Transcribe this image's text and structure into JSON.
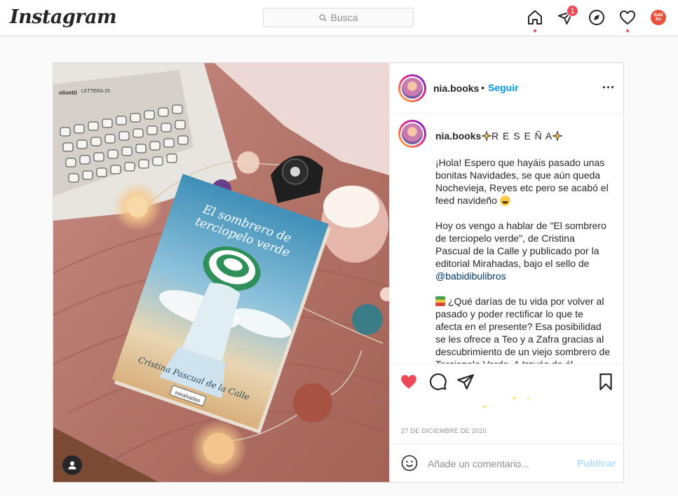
{
  "nav": {
    "logo": "Instagram",
    "search_placeholder": "Busca",
    "notifications_count": "1",
    "avatar_text": "Babi Bu"
  },
  "post": {
    "username": "nia.books",
    "separator": "•",
    "follow_label": "Seguir",
    "caption_title": "R E S E Ñ A",
    "caption_p1": "¡Hola! Espero que hayáis pasado unas bonitas Navidades, se que aún queda Nochevieja, Reyes etc pero se acabó el feed navideño",
    "caption_p2_a": "Hoy os vengo a hablar de \"El sombrero de terciopelo verde\", de Cristina Pascual de la Calle y publicado por la editorial Mirahadas, bajo el sello de",
    "caption_p2_mention": "@babidibulibros",
    "caption_p3": "¿Qué darías de tu vida por volver al pasado y poder rectificar lo que te afecta en el presente? Esa posibilidad se les ofrece a Teo y a Zafra gracias al descubrimiento de un viejo sombrero de Terciopelo Verde. A través de él",
    "date": "27 DE DICIEMBRE DE 2020",
    "comment_placeholder": "Añade un comentario...",
    "publish_label": "Publicar"
  },
  "photo": {
    "book_title_line1": "El sombrero de",
    "book_title_line2": "terciopelo verde",
    "book_author": "Cristina Pascual de la Calle",
    "book_publisher": "mirahadas",
    "typewriter_brand": "olivetti",
    "typewriter_model": "LETTERA 25"
  },
  "colors": {
    "accent": "#0095f6",
    "like": "#ed4956",
    "text": "#262626",
    "muted": "#8e8e8e"
  },
  "icons": [
    "search-icon",
    "home-icon",
    "direct-icon",
    "explore-icon",
    "activity-icon",
    "heart-icon",
    "comment-icon",
    "share-icon",
    "bookmark-icon",
    "emoji-icon",
    "user-tag-icon",
    "more-icon"
  ]
}
